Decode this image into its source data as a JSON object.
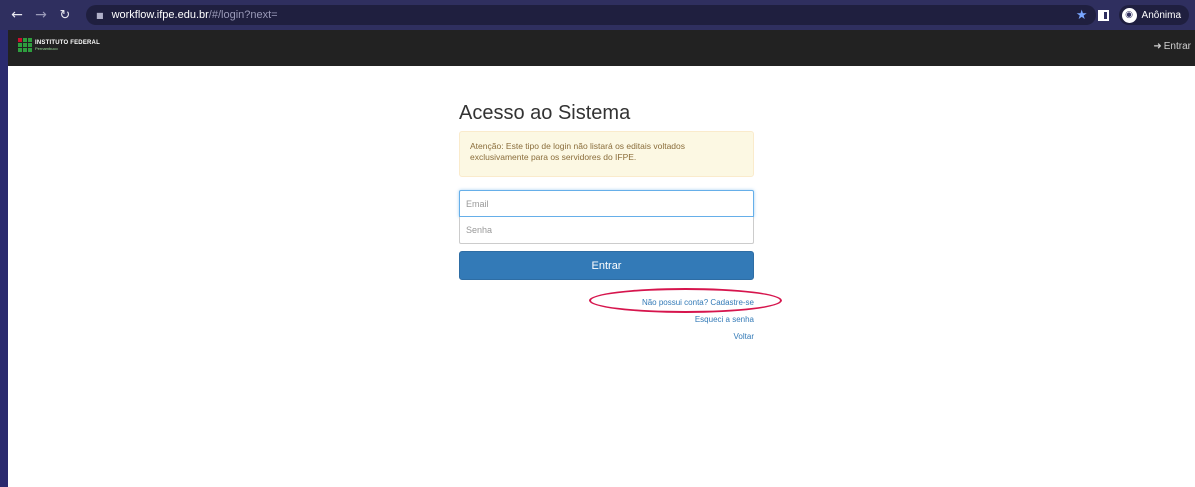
{
  "browser": {
    "url_host": "workflow.ifpe.edu.br",
    "url_path": "/#/login?next=",
    "profile_label": "Anônima",
    "icons": [
      "back-icon",
      "forward-icon",
      "reload-icon",
      "lock-icon",
      "star-icon",
      "side-panel-icon",
      "incognito-icon"
    ]
  },
  "header": {
    "logo_title": "INSTITUTO FEDERAL",
    "logo_subtitle": "Pernambuco",
    "login_label": "Entrar"
  },
  "login": {
    "title": "Acesso ao Sistema",
    "alert_text": "Atenção: Este tipo de login não listará os editais voltados exclusivamente para os servidores do IFPE.",
    "email_placeholder": "Email",
    "password_placeholder": "Senha",
    "submit_label": "Entrar",
    "register_link": "Não possui conta? Cadastre-se",
    "forgot_link": "Esqueci a senha",
    "back_link": "Voltar"
  },
  "colors": {
    "primary": "#337ab7",
    "alert_bg": "#fcf8e3",
    "alert_text": "#8a6d3b",
    "header_bg": "#222222",
    "highlight": "#d6154d"
  }
}
